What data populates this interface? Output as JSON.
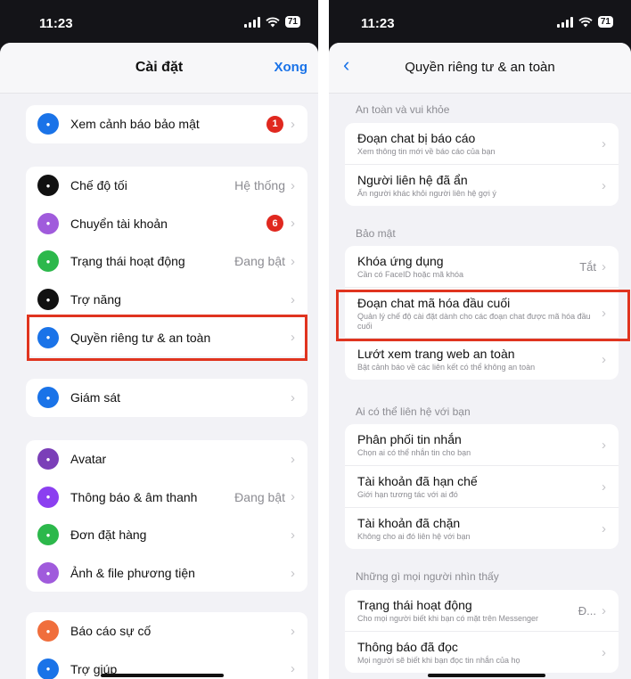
{
  "left": {
    "status_time": "11:23",
    "battery": "71",
    "title": "Cài đặt",
    "done": "Xong",
    "groups": [
      [
        {
          "label": "Xem cảnh báo bảo mật",
          "icon": "shield-home-icon",
          "color": "#1a73e8",
          "badge": "1"
        }
      ],
      [
        {
          "label": "Chế độ tối",
          "icon": "moon-icon",
          "color": "#111111",
          "value": "Hệ thống"
        },
        {
          "label": "Chuyển tài khoản",
          "icon": "switch-account-icon",
          "color": "#a05bdc",
          "badge": "6"
        },
        {
          "label": "Trạng thái hoạt động",
          "icon": "active-status-icon",
          "color": "#2cb84b",
          "value": "Đang bật"
        },
        {
          "label": "Trợ năng",
          "icon": "accessibility-icon",
          "color": "#111111"
        },
        {
          "label": "Quyền riêng tư & an toàn",
          "icon": "privacy-icon",
          "color": "#1a73e8"
        }
      ],
      [
        {
          "label": "Giám sát",
          "icon": "supervision-icon",
          "color": "#1a73e8"
        }
      ],
      [
        {
          "label": "Avatar",
          "icon": "avatar-icon",
          "color": "#7b3fb8"
        },
        {
          "label": "Thông báo & âm thanh",
          "icon": "bell-icon",
          "color": "#8b3ff0",
          "value": "Đang bật"
        },
        {
          "label": "Đơn đặt hàng",
          "icon": "orders-icon",
          "color": "#2cb84b"
        },
        {
          "label": "Ảnh & file phương tiện",
          "icon": "media-icon",
          "color": "#a05bdc"
        }
      ],
      [
        {
          "label": "Báo cáo sự cố",
          "icon": "warning-icon",
          "color": "#f06e3c"
        },
        {
          "label": "Trợ giúp",
          "icon": "help-icon",
          "color": "#1a73e8"
        }
      ]
    ]
  },
  "right": {
    "status_time": "11:23",
    "battery": "71",
    "title": "Quyền riêng tư & an toàn",
    "sections": [
      {
        "header": "An toàn và vui khỏe",
        "items": [
          {
            "title": "Đoạn chat bị báo cáo",
            "sub": "Xem thông tin mới về báo cáo của bạn"
          },
          {
            "title": "Người liên hệ đã ẩn",
            "sub": "Ẩn người khác khỏi người liên hệ gợi ý"
          }
        ]
      },
      {
        "header": "Bảo mật",
        "items": [
          {
            "title": "Khóa ứng dụng",
            "sub": "Cần có FaceID hoặc mã khóa",
            "value": "Tắt"
          },
          {
            "title": "Đoạn chat mã hóa đầu cuối",
            "sub": "Quản lý chế độ cài đặt dành cho các đoạn chat được mã hóa đầu cuối"
          },
          {
            "title": "Lướt xem trang web an toàn",
            "sub": "Bật cảnh báo về các liên kết có thể không an toàn"
          }
        ]
      },
      {
        "header": "Ai có thể liên hệ với bạn",
        "items": [
          {
            "title": "Phân phối tin nhắn",
            "sub": "Chọn ai có thể nhắn tin cho bạn"
          },
          {
            "title": "Tài khoản đã hạn chế",
            "sub": "Giới hạn tương tác với ai đó"
          },
          {
            "title": "Tài khoản đã chặn",
            "sub": "Không cho ai đó liên hệ với bạn"
          }
        ]
      },
      {
        "header": "Những gì mọi người nhìn thấy",
        "items": [
          {
            "title": "Trạng thái hoạt động",
            "sub": "Cho mọi người biết khi bạn có mặt trên Messenger",
            "value": "Đ..."
          },
          {
            "title": "Thông báo đã đọc",
            "sub": "Mọi người sẽ biết khi bạn đọc tin nhắn của họ"
          }
        ]
      }
    ]
  },
  "colors": {
    "accent": "#1a73e8",
    "highlight": "#e0341f",
    "badge": "#e0281f"
  }
}
